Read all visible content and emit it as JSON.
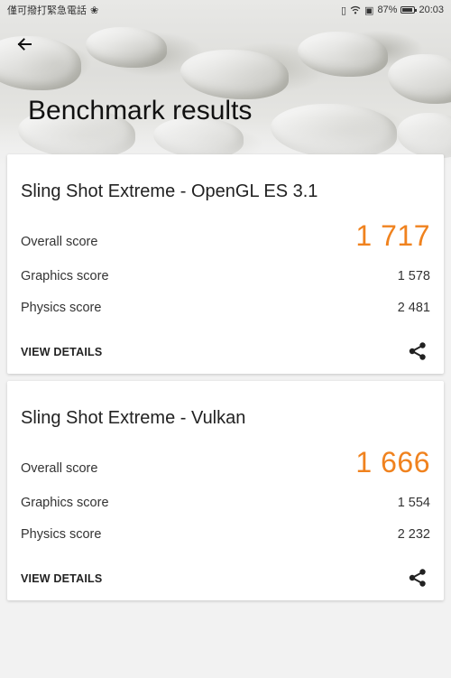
{
  "status_bar": {
    "carrier_text": "僅可撥打緊急電話",
    "battery_percent": "87%",
    "time": "20:03"
  },
  "header": {
    "title": "Benchmark results"
  },
  "results": [
    {
      "test_name": "Sling Shot Extreme - OpenGL ES 3.1",
      "overall_label": "Overall score",
      "overall_value": "1 717",
      "graphics_label": "Graphics score",
      "graphics_value": "1 578",
      "physics_label": "Physics score",
      "physics_value": "2 481",
      "details_label": "VIEW DETAILS"
    },
    {
      "test_name": "Sling Shot Extreme - Vulkan",
      "overall_label": "Overall score",
      "overall_value": "1 666",
      "graphics_label": "Graphics score",
      "graphics_value": "1 554",
      "physics_label": "Physics score",
      "physics_value": "2 232",
      "details_label": "VIEW DETAILS"
    }
  ],
  "colors": {
    "accent": "#f0821e",
    "background": "#f2f2f2",
    "card": "#ffffff"
  },
  "icons": [
    "back-arrow-icon",
    "share-icon",
    "wifi-icon",
    "battery-icon",
    "vibrate-icon"
  ]
}
